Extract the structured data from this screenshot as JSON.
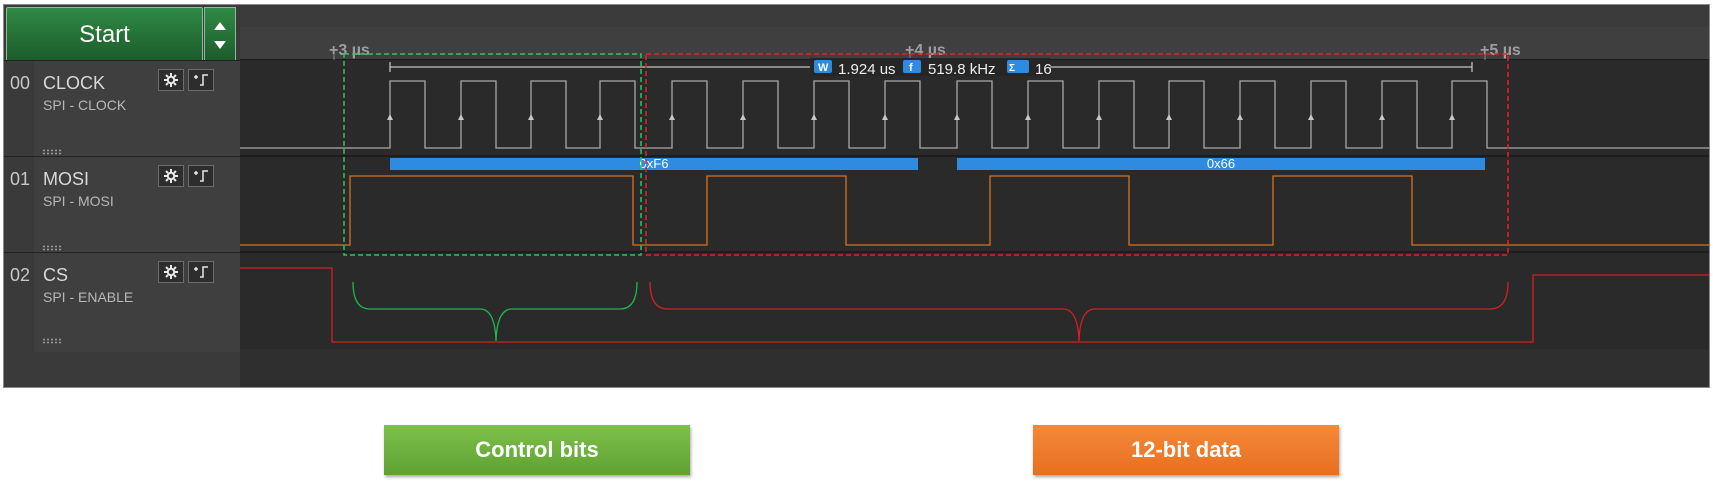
{
  "toolbar": {
    "start_label": "Start"
  },
  "timeline": {
    "ticks": [
      "+3 µs",
      "+4 µs",
      "+5 µs"
    ]
  },
  "measurement": {
    "width_value": "1.924 us",
    "freq_value": "519.8 kHz",
    "count_value": "16"
  },
  "channels": [
    {
      "num": "00",
      "name": "CLOCK",
      "sub": "SPI - CLOCK"
    },
    {
      "num": "01",
      "name": "MOSI",
      "sub": "SPI - MOSI"
    },
    {
      "num": "02",
      "name": "CS",
      "sub": "SPI - ENABLE"
    }
  ],
  "decoded_bytes": [
    "0xF6",
    "0x66"
  ],
  "annotations": {
    "control_label": "Control bits",
    "data_label": "12-bit data"
  },
  "colors": {
    "clock_trace": "#a9a9a9",
    "mosi_trace": "#d9721c",
    "cs_trace": "#d42020",
    "decode_bar": "#2e8be0",
    "control_highlight": "#28c45a",
    "data_highlight": "#e02020",
    "control_box": "#6db33f",
    "data_box": "#ef7a2a"
  },
  "icons": [
    "chevron-up-icon",
    "chevron-down-icon",
    "gear-icon",
    "trigger-edge-icon",
    "width-icon",
    "frequency-icon",
    "count-icon"
  ]
}
